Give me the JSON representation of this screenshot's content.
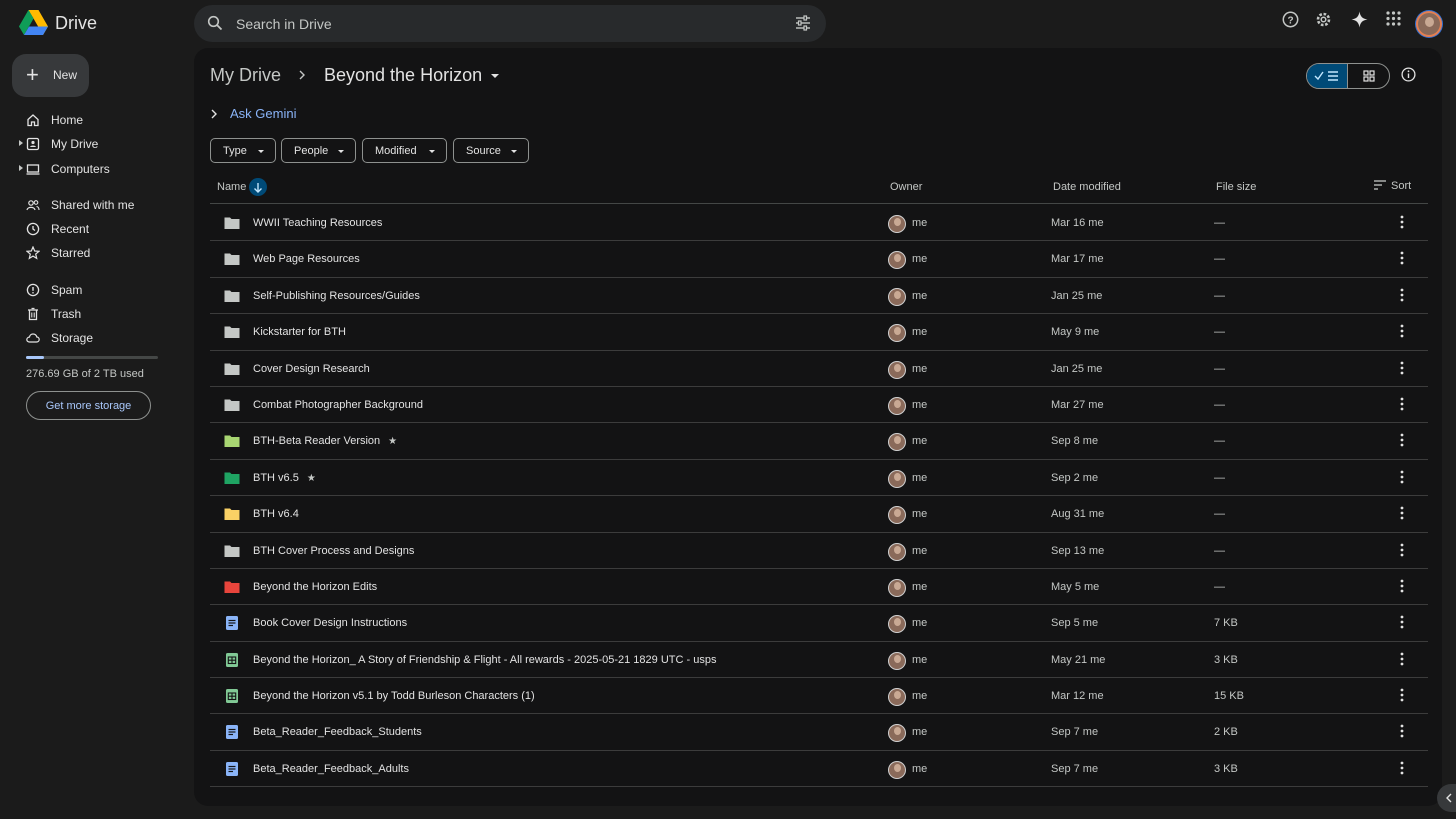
{
  "app": {
    "title": "Drive"
  },
  "search": {
    "placeholder": "Search in Drive"
  },
  "sidebar": {
    "new_label": "New",
    "items": [
      {
        "label": "Home",
        "icon": "home-icon"
      },
      {
        "label": "My Drive",
        "icon": "my-drive-icon"
      },
      {
        "label": "Computers",
        "icon": "computer-icon"
      },
      {
        "label": "Shared with me",
        "icon": "people-icon"
      },
      {
        "label": "Recent",
        "icon": "clock-icon"
      },
      {
        "label": "Starred",
        "icon": "star-icon"
      },
      {
        "label": "Spam",
        "icon": "spam-icon"
      },
      {
        "label": "Trash",
        "icon": "trash-icon"
      },
      {
        "label": "Storage",
        "icon": "cloud-icon"
      }
    ],
    "storage_used_fraction": 0.135,
    "storage_text": "276.69 GB of 2 TB used",
    "get_storage_label": "Get more storage"
  },
  "breadcrumb": {
    "root": "My Drive",
    "current": "Beyond the Horizon"
  },
  "gemini": {
    "label": "Ask Gemini"
  },
  "filters": [
    "Type",
    "People",
    "Modified",
    "Source"
  ],
  "table": {
    "columns": {
      "name": "Name",
      "owner": "Owner",
      "date": "Date modified",
      "size": "File size",
      "sort": "Sort"
    },
    "rows": [
      {
        "name": "WWII Teaching Resources",
        "type": "folder",
        "color": "#c4c7c5",
        "starred": false,
        "owner": "me",
        "date": "Mar 16 me",
        "size": "—"
      },
      {
        "name": "Web Page Resources",
        "type": "folder",
        "color": "#c4c7c5",
        "starred": false,
        "owner": "me",
        "date": "Mar 17 me",
        "size": "—"
      },
      {
        "name": "Self-Publishing Resources/Guides",
        "type": "folder",
        "color": "#c4c7c5",
        "starred": false,
        "owner": "me",
        "date": "Jan 25 me",
        "size": "—"
      },
      {
        "name": "Kickstarter for BTH",
        "type": "folder",
        "color": "#c4c7c5",
        "starred": false,
        "owner": "me",
        "date": "May 9 me",
        "size": "—"
      },
      {
        "name": "Cover Design Research",
        "type": "folder",
        "color": "#c4c7c5",
        "starred": false,
        "owner": "me",
        "date": "Jan 25 me",
        "size": "—"
      },
      {
        "name": "Combat Photographer Background",
        "type": "folder",
        "color": "#c4c7c5",
        "starred": false,
        "owner": "me",
        "date": "Mar 27 me",
        "size": "—"
      },
      {
        "name": "BTH-Beta Reader Version",
        "type": "folder",
        "color": "#a8d672",
        "starred": true,
        "owner": "me",
        "date": "Sep 8 me",
        "size": "—"
      },
      {
        "name": "BTH v6.5",
        "type": "folder",
        "color": "#1fa463",
        "starred": true,
        "owner": "me",
        "date": "Sep 2 me",
        "size": "—"
      },
      {
        "name": "BTH v6.4",
        "type": "folder",
        "color": "#fad165",
        "starred": false,
        "owner": "me",
        "date": "Aug 31 me",
        "size": "—"
      },
      {
        "name": "BTH Cover Process and Designs",
        "type": "folder",
        "color": "#c4c7c5",
        "starred": false,
        "owner": "me",
        "date": "Sep 13 me",
        "size": "—"
      },
      {
        "name": "Beyond the Horizon Edits",
        "type": "folder",
        "color": "#e8453c",
        "starred": false,
        "owner": "me",
        "date": "May 5 me",
        "size": "—"
      },
      {
        "name": "Book Cover Design Instructions",
        "type": "doc",
        "color": "#8ab4f8",
        "starred": false,
        "owner": "me",
        "date": "Sep 5 me",
        "size": "7 KB"
      },
      {
        "name": "Beyond the Horizon_ A Story of Friendship & Flight - All rewards - 2025-05-21 1829 UTC - usps",
        "type": "sheet",
        "color": "#81c995",
        "starred": false,
        "owner": "me",
        "date": "May 21 me",
        "size": "3 KB"
      },
      {
        "name": "Beyond the Horizon v5.1 by Todd Burleson Characters (1)",
        "type": "sheet",
        "color": "#81c995",
        "starred": false,
        "owner": "me",
        "date": "Mar 12 me",
        "size": "15 KB"
      },
      {
        "name": "Beta_Reader_Feedback_Students",
        "type": "doc",
        "color": "#8ab4f8",
        "starred": false,
        "owner": "me",
        "date": "Sep 7 me",
        "size": "2 KB"
      },
      {
        "name": "Beta_Reader_Feedback_Adults",
        "type": "doc",
        "color": "#8ab4f8",
        "starred": false,
        "owner": "me",
        "date": "Sep 7 me",
        "size": "3 KB"
      }
    ]
  }
}
